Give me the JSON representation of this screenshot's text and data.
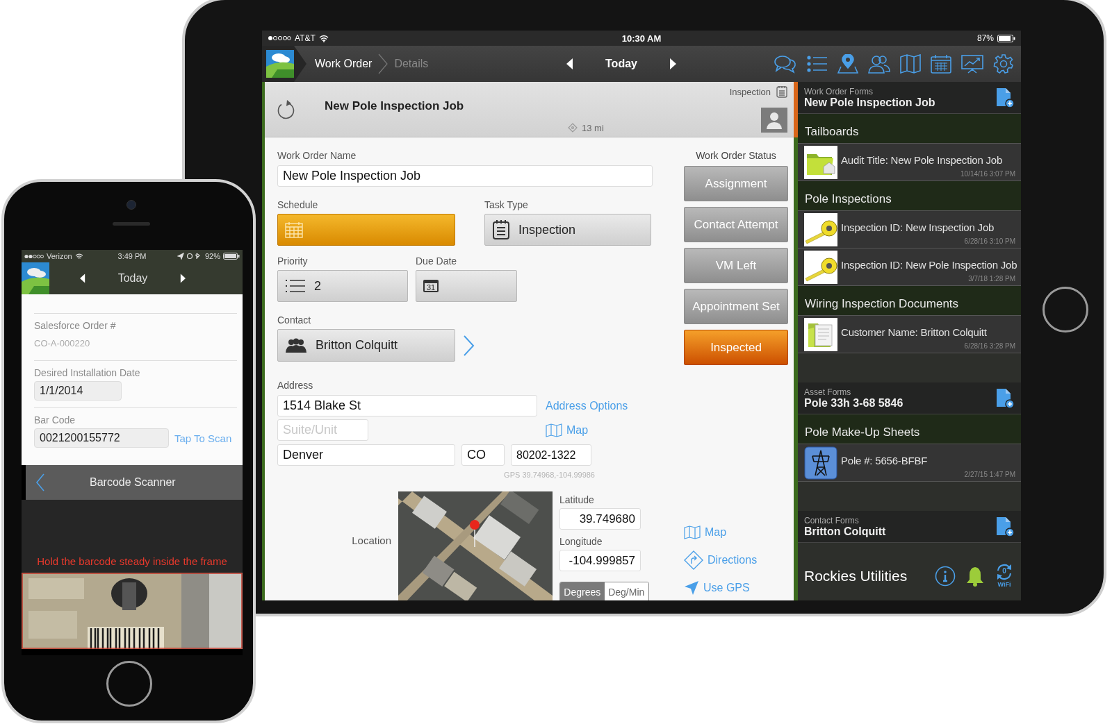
{
  "ipad": {
    "status_bar": {
      "carrier": "AT&T",
      "time": "10:30 AM",
      "battery": "87%"
    },
    "nav": {
      "breadcrumbs": [
        {
          "label": "Work Order",
          "selected": true
        },
        {
          "label": "Details",
          "selected": false
        }
      ],
      "date": "Today"
    },
    "header": {
      "title": "New Pole Inspection Job",
      "task_type": "Inspection",
      "distance": "13 mi"
    },
    "form": {
      "work_order_name": {
        "label": "Work Order Name",
        "value": "New Pole Inspection Job"
      },
      "schedule": {
        "label": "Schedule"
      },
      "task_type": {
        "label": "Task Type",
        "value": "Inspection"
      },
      "priority": {
        "label": "Priority",
        "value": "2"
      },
      "due_date": {
        "label": "Due Date",
        "icon_day": "31"
      },
      "contact": {
        "label": "Contact",
        "value": "Britton Colquitt"
      },
      "address": {
        "label": "Address",
        "street": "1514 Blake St",
        "suite_placeholder": "Suite/Unit",
        "city": "Denver",
        "state": "CO",
        "zip": "80202-1322",
        "gps": "GPS 39.74968,-104.99986",
        "options_link": "Address Options",
        "map_link": "Map"
      },
      "location": {
        "label": "Location",
        "latitude_label": "Latitude",
        "latitude": "39.749680",
        "longitude_label": "Longitude",
        "longitude": "-104.999857",
        "units": [
          {
            "label": "Degrees",
            "selected": true
          },
          {
            "label": "Deg/Min",
            "selected": false
          }
        ],
        "actions": [
          {
            "kind": "map",
            "label": "Map"
          },
          {
            "kind": "directions",
            "label": "Directions"
          },
          {
            "kind": "gps",
            "label": "Use GPS"
          }
        ]
      }
    },
    "status": {
      "title": "Work Order Status",
      "options": [
        {
          "label": "Assignment",
          "selected": false
        },
        {
          "label": "Contact Attempt",
          "selected": false
        },
        {
          "label": "VM Left",
          "selected": false
        },
        {
          "label": "Appointment Set",
          "selected": false
        },
        {
          "label": "Inspected",
          "selected": true
        }
      ]
    },
    "sidebar": {
      "sections": [
        {
          "kind": "form",
          "label": "Work Order Forms",
          "title": "New Pole Inspection Job"
        },
        {
          "kind": "group",
          "title": "Tailboards",
          "items": [
            {
              "kind": "folder",
              "text": "Audit Title: New Pole Inspection Job",
              "date": "10/14/16 3:07 PM"
            }
          ]
        },
        {
          "kind": "group",
          "title": "Pole Inspections",
          "items": [
            {
              "kind": "tape",
              "text": "Inspection ID: New Inspection Job",
              "date": "6/28/16 3:10 PM"
            },
            {
              "kind": "tape",
              "text": "Inspection ID: New Pole Inspection Job",
              "date": "3/7/18 1:28 PM"
            }
          ]
        },
        {
          "kind": "group",
          "title": "Wiring Inspection Documents",
          "items": [
            {
              "kind": "document",
              "text": "Customer Name: Britton Colquitt",
              "date": "6/28/16 3:28 PM"
            }
          ]
        },
        {
          "kind": "form",
          "label": "Asset Forms",
          "title": "Pole 33h 3-68 5846"
        },
        {
          "kind": "group",
          "title": "Pole Make-Up Sheets",
          "items": [
            {
              "kind": "tower",
              "text": "Pole #: 5656-BFBF",
              "date": "2/27/15 1:47 PM"
            }
          ]
        },
        {
          "kind": "form",
          "label": "Contact Forms",
          "title": "Britton Colquitt"
        }
      ],
      "footer": {
        "title": "Rockies Utilities",
        "sync_count": "0",
        "sync_label": "WiFi"
      }
    }
  },
  "iphone": {
    "status_bar": {
      "carrier": "Verizon",
      "time": "3:49 PM",
      "battery": "92%"
    },
    "nav": {
      "date": "Today"
    },
    "fields": [
      {
        "kind": "text",
        "label": "Salesforce Order #",
        "value": "CO-A-000220"
      },
      {
        "kind": "input",
        "label": "Desired Installation Date",
        "value": "1/1/2014"
      },
      {
        "kind": "input_action",
        "label": "Bar Code",
        "value": "0021200155772",
        "action": "Tap To Scan"
      }
    ],
    "scanner": {
      "title": "Barcode Scanner",
      "hint": "Hold the barcode steady inside the frame"
    }
  }
}
